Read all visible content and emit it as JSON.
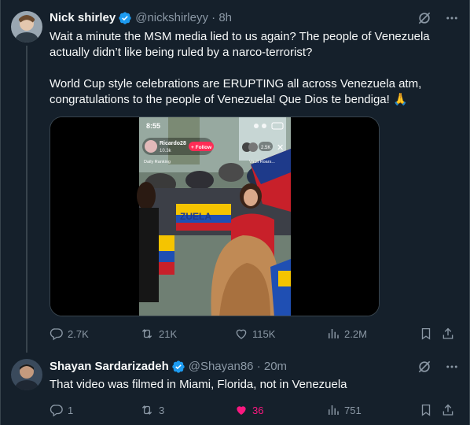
{
  "tweet1": {
    "name": "Nick shirley",
    "handle": "@nickshirleyy",
    "time": "8h",
    "text": "Wait a minute the MSM media lied to us again? The people of Venezuela actually didn’t like being ruled by a narco-terrorist?\n\nWorld Cup style celebrations are ERUPTING all across Venezuela atm, congratulations to the people of Venezuela! Que Dios te bendiga! 🙏",
    "media": {
      "status_time": "8:55",
      "live_user": "Ricardo28",
      "live_sub": "10.3k",
      "follow_label": "+ Follow",
      "ranking_label": "Daily Ranking",
      "viewers": "2.5K",
      "vault_label": "Vault Roars...",
      "banner_text": "ZUELA"
    },
    "replies": "2.7K",
    "retweets": "21K",
    "likes": "115K",
    "views": "2.2M"
  },
  "tweet2": {
    "name": "Shayan Sardarizadeh",
    "handle": "@Shayan86",
    "time": "20m",
    "text": "That video was filmed in Miami, Florida, not in Venezuela",
    "replies": "1",
    "retweets": "3",
    "likes": "36",
    "views": "751"
  },
  "colors": {
    "background": "#15202b",
    "text": "#f7f9f9",
    "muted": "#8b98a5",
    "verified": "#1d9bf0",
    "like_active": "#f91880"
  }
}
